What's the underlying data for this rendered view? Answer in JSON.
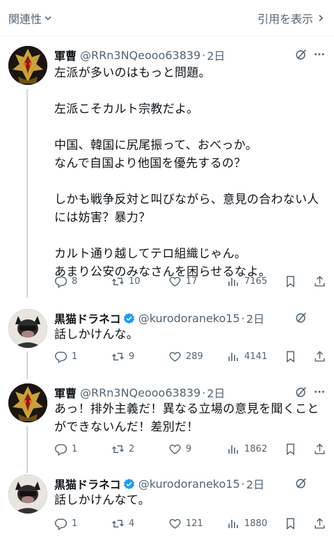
{
  "header": {
    "sort_label": "関連性",
    "quotes_label": "引用を表示"
  },
  "tweets": [
    {
      "name": "軍曹",
      "handle": "@RRn3NQeooo63839",
      "time": "2日",
      "verified": false,
      "text": "左派が多いのはもっと問題。\n\n左派こそカルト宗教だよ。\n\n中国、韓国に尻尾振って、おべっか。\nなんで自国より他国を優先するの？\n\nしかも戦争反対と叫びながら、意見の合わない人には妨害？暴力？\n\nカルト通り越してテロ組織じゃん。\nあまり公安のみなさんを困らせるなよ。",
      "replies": "8",
      "retweets": "10",
      "likes": "17",
      "views": "7165"
    },
    {
      "name": "黒猫ドラネコ",
      "handle": "@kurodoraneko15",
      "time": "2日",
      "verified": true,
      "text": "話しかけんな。",
      "replies": "1",
      "retweets": "9",
      "likes": "289",
      "views": "4141"
    },
    {
      "name": "軍曹",
      "handle": "@RRn3NQeooo63839",
      "time": "2日",
      "verified": false,
      "text": "あっ！排外主義だ！異なる立場の意見を聞くことができないんだ！差別だ！",
      "replies": "1",
      "retweets": "2",
      "likes": "9",
      "views": "1862"
    },
    {
      "name": "黒猫ドラネコ",
      "handle": "@kurodoraneko15",
      "time": "2日",
      "verified": true,
      "text": "話しかけんなて。",
      "replies": "1",
      "retweets": "4",
      "likes": "121",
      "views": "1880"
    }
  ],
  "colors": {
    "text": "#0f1419",
    "muted": "#536471",
    "verified": "#1d9bf0",
    "thread_line": "#cfd9de"
  }
}
